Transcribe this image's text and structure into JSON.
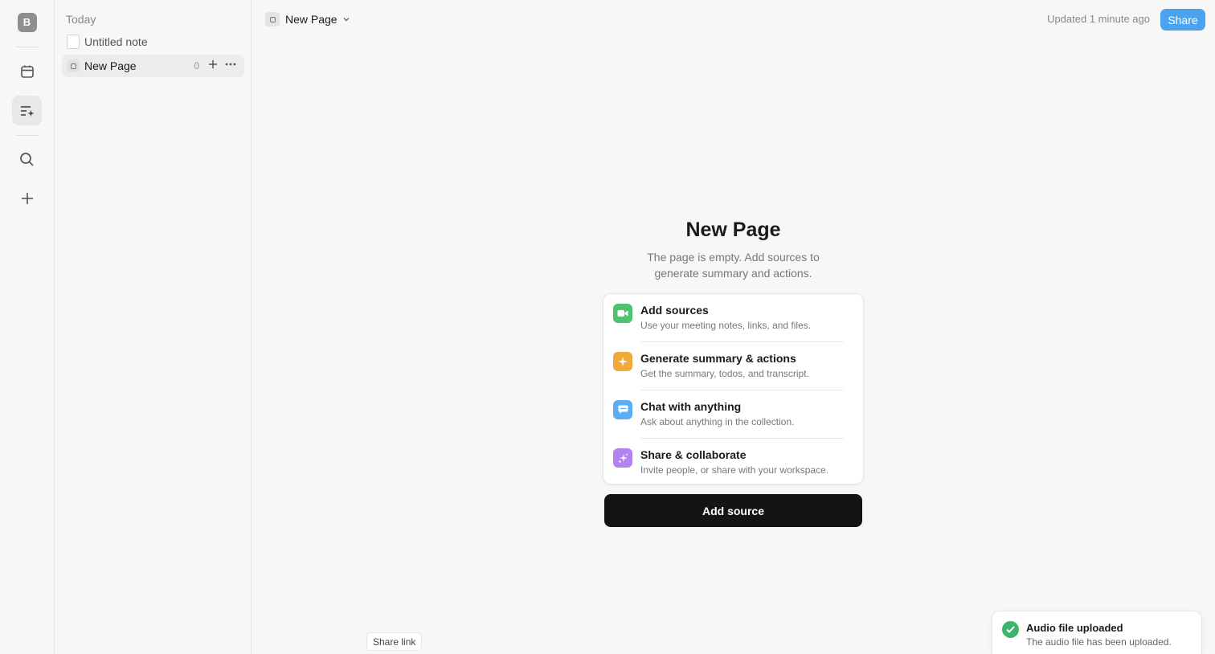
{
  "rail": {
    "avatar_letter": "B",
    "icons": [
      "calendar-icon",
      "notes-sparkle-icon",
      "search-icon",
      "plus-icon"
    ]
  },
  "sidebar": {
    "section_label": "Today",
    "items": [
      {
        "title": "Untitled note"
      },
      {
        "title": "New Page",
        "count": "0"
      }
    ]
  },
  "header": {
    "title": "New Page",
    "updated": "Updated 1 minute ago",
    "share_label": "Share"
  },
  "main": {
    "title": "New Page",
    "subtitle": "The page is empty. Add sources to generate summary and actions.",
    "features": [
      {
        "title": "Add sources",
        "desc": "Use your meeting notes, links, and files.",
        "color": "#4cc36f",
        "icon": "video-icon"
      },
      {
        "title": "Generate summary & actions",
        "desc": "Get the summary, todos, and transcript.",
        "color": "#f0a93a",
        "icon": "sparkle-icon"
      },
      {
        "title": "Chat with anything",
        "desc": "Ask about anything in the collection.",
        "color": "#59aef5",
        "icon": "chat-icon"
      },
      {
        "title": "Share & collaborate",
        "desc": "Invite people, or share with your workspace.",
        "color": "#b583ef",
        "icon": "share-sparkle-icon"
      }
    ],
    "add_source_label": "Add source"
  },
  "footer": {
    "share_link_label": "Share link"
  },
  "toast": {
    "title": "Audio file uploaded",
    "desc": "The audio file has been uploaded."
  }
}
